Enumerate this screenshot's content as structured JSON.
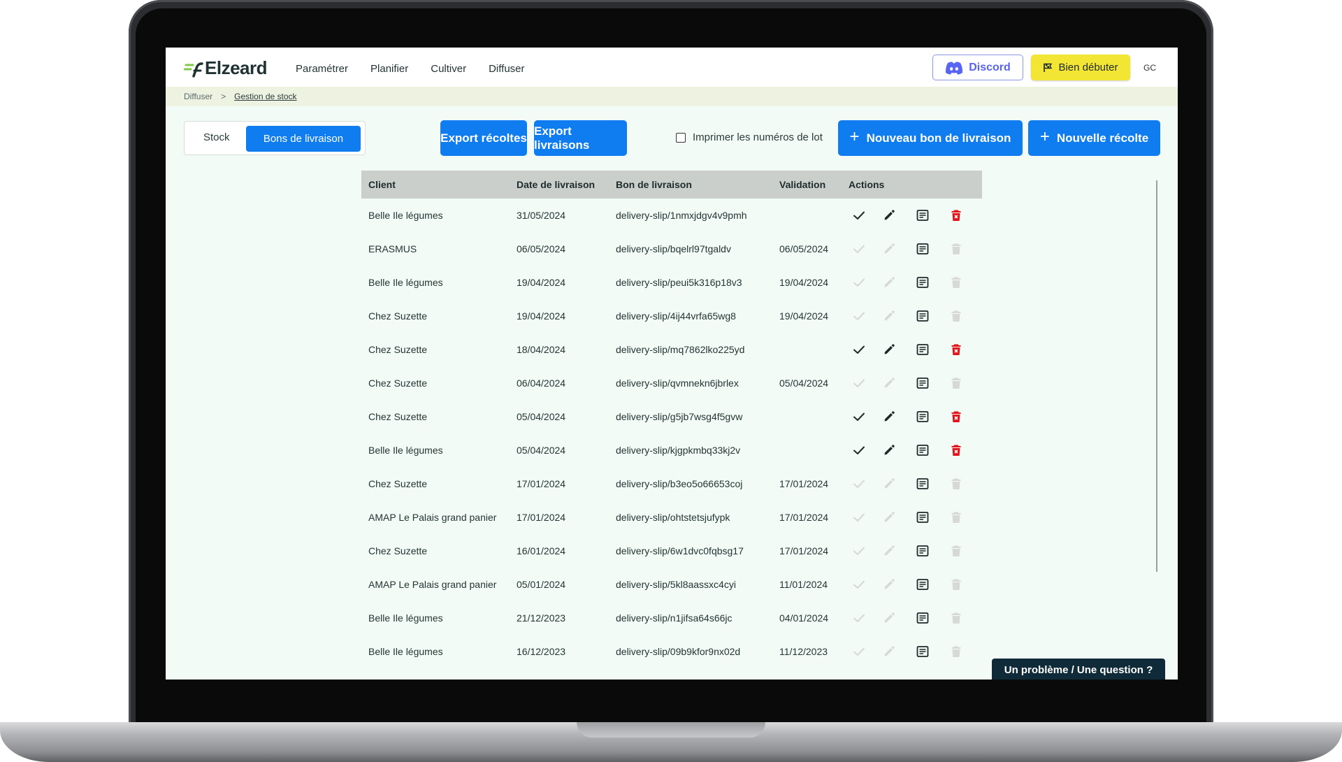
{
  "app": {
    "name": "Elzeard"
  },
  "nav": [
    "Paramétrer",
    "Planifier",
    "Cultiver",
    "Diffuser"
  ],
  "header": {
    "discord_label": "Discord",
    "start_label": "Bien débuter",
    "avatar_initials": "GC"
  },
  "breadcrumb": {
    "parent": "Diffuser",
    "separator": ">",
    "current": "Gestion de stock"
  },
  "toggle": {
    "stock": "Stock",
    "delivery": "Bons de livraison"
  },
  "toolbar": {
    "export_harvests": "Export récoltes",
    "export_deliveries": "Export livraisons",
    "print_lots": "Imprimer les numéros de lot",
    "new_delivery": "Nouveau bon de livraison",
    "new_harvest": "Nouvelle récolte"
  },
  "table": {
    "headers": [
      "Client",
      "Date de livraison",
      "Bon de livraison",
      "Validation",
      "Actions"
    ],
    "rows": [
      {
        "client": "Belle Ile légumes",
        "date": "31/05/2024",
        "slip": "delivery-slip/1nmxjdgv4v9pmh",
        "validation": "",
        "editable": true
      },
      {
        "client": "ERASMUS",
        "date": "06/05/2024",
        "slip": "delivery-slip/bqelrl97tgaldv",
        "validation": "06/05/2024",
        "editable": false
      },
      {
        "client": "Belle Ile légumes",
        "date": "19/04/2024",
        "slip": "delivery-slip/peui5k316p18v3",
        "validation": "19/04/2024",
        "editable": false
      },
      {
        "client": "Chez Suzette",
        "date": "19/04/2024",
        "slip": "delivery-slip/4ij44vrfa65wg8",
        "validation": "19/04/2024",
        "editable": false
      },
      {
        "client": "Chez Suzette",
        "date": "18/04/2024",
        "slip": "delivery-slip/mq7862lko225yd",
        "validation": "",
        "editable": true
      },
      {
        "client": "Chez Suzette",
        "date": "06/04/2024",
        "slip": "delivery-slip/qvmnekn6jbrlex",
        "validation": "05/04/2024",
        "editable": false
      },
      {
        "client": "Chez Suzette",
        "date": "05/04/2024",
        "slip": "delivery-slip/g5jb7wsg4f5gvw",
        "validation": "",
        "editable": true
      },
      {
        "client": "Belle Ile légumes",
        "date": "05/04/2024",
        "slip": "delivery-slip/kjgpkmbq33kj2v",
        "validation": "",
        "editable": true
      },
      {
        "client": "Chez Suzette",
        "date": "17/01/2024",
        "slip": "delivery-slip/b3eo5o66653coj",
        "validation": "17/01/2024",
        "editable": false
      },
      {
        "client": "AMAP Le Palais grand panier",
        "date": "17/01/2024",
        "slip": "delivery-slip/ohtstetsjufypk",
        "validation": "17/01/2024",
        "editable": false
      },
      {
        "client": "Chez Suzette",
        "date": "16/01/2024",
        "slip": "delivery-slip/6w1dvc0fqbsg17",
        "validation": "17/01/2024",
        "editable": false
      },
      {
        "client": "AMAP Le Palais grand panier",
        "date": "05/01/2024",
        "slip": "delivery-slip/5kl8aassxc4cyi",
        "validation": "11/01/2024",
        "editable": false
      },
      {
        "client": "Belle Ile légumes",
        "date": "21/12/2023",
        "slip": "delivery-slip/n1jifsa64s66jc",
        "validation": "04/01/2024",
        "editable": false
      },
      {
        "client": "Belle Ile légumes",
        "date": "16/12/2023",
        "slip": "delivery-slip/09b9kfor9nx02d",
        "validation": "11/12/2023",
        "editable": false
      }
    ]
  },
  "help": {
    "label": "Un problème / Une question ?"
  },
  "colors": {
    "primary": "#0f7df0",
    "accent_yellow": "#f2e533",
    "danger": "#e0131b",
    "disabled": "#d6d9d7",
    "discord": "#5865f2"
  },
  "icons": [
    "check-icon",
    "pencil-icon",
    "document-icon",
    "trash-icon",
    "discord-icon",
    "flag-icon",
    "plus-icon"
  ]
}
